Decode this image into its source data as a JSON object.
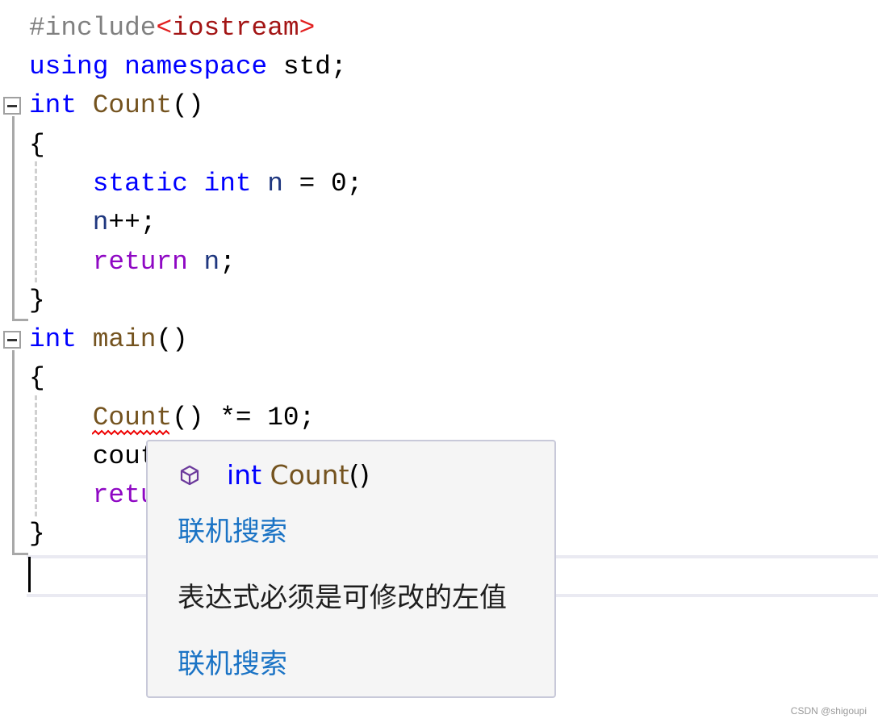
{
  "code": {
    "l1": {
      "pp": "#include",
      "ang1": "<",
      "inc": "iostream",
      "ang2": ">"
    },
    "l2": {
      "kw1": "using",
      "kw2": "namespace",
      "rest": " std;"
    },
    "l3": {
      "kw": "int",
      "fn": "Count",
      "rest": "()"
    },
    "l4": "{",
    "l5": {
      "kw1": "static",
      "kw2": "int",
      "var": "n",
      "rest": " = 0;"
    },
    "l6": {
      "var": "n",
      "rest": "++;"
    },
    "l7": {
      "kw": "return",
      "var": "n",
      "rest": ";"
    },
    "l8": "}",
    "l9": {
      "kw": "int",
      "fn": "main",
      "rest": "()"
    },
    "l10": "{",
    "l11": {
      "fn": "Count",
      "rest": "() *= 10;"
    },
    "l12": "cout",
    "l13": "retu",
    "l14": "}"
  },
  "tooltip": {
    "icon": "cube-icon",
    "sig_kw": "int",
    "sig_fn": "Count",
    "sig_rest": "()",
    "search1": "联机搜索",
    "error": "表达式必须是可修改的左值",
    "search2": "联机搜索"
  },
  "watermark": "CSDN @shigoupi"
}
